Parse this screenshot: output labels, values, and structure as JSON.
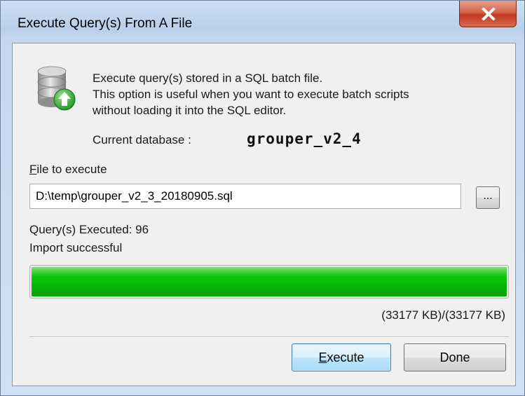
{
  "window": {
    "title": "Execute Query(s) From A File",
    "close_icon": "close-icon"
  },
  "description": {
    "line1": "Execute query(s) stored in a SQL batch file.",
    "line2": "This option is useful when you want to execute batch scripts",
    "line3": "without loading it into the SQL editor.",
    "icon": "database-import-icon"
  },
  "current_database": {
    "label": "Current database :",
    "value": "grouper_v2_4"
  },
  "file": {
    "label_accel": "F",
    "label_rest": "ile to execute",
    "value": "D:\\temp\\grouper_v2_3_20180905.sql",
    "browse_label": "..."
  },
  "status": {
    "executed": "Query(s) Executed: 96",
    "result": "Import successful",
    "progress_percent": 100,
    "size": "(33177 KB)/(33177 KB)"
  },
  "buttons": {
    "execute_accel": "E",
    "execute_rest": "xecute",
    "done": "Done"
  },
  "colors": {
    "progress": "#16c514",
    "close_button": "#c2391f"
  }
}
